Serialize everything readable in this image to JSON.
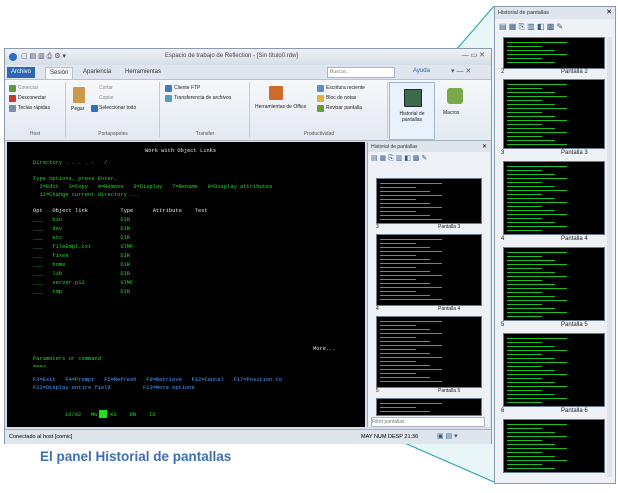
{
  "window": {
    "title": "Espacio de trabajo de Reflection - [Sin título0.rdw]",
    "search_placeholder": "Buscar...",
    "help_label": "Ayuda"
  },
  "ribbon": {
    "tabs": [
      "Archivo",
      "Sesión",
      "Apariencia",
      "Herramientas"
    ],
    "host": {
      "conectar": "Conectar",
      "desconectar": "Desconectar",
      "teclas_rapidas": "Teclas rápidas",
      "label": "Host"
    },
    "clipboard": {
      "pegar": "Pegar",
      "cortar": "Cortar",
      "copiar": "Copiar",
      "seleccionar_todo": "Seleccionar todo",
      "label": "Portapapeles"
    },
    "transfer": {
      "cliente_ftp": "Cliente FTP",
      "transferencia": "Transferencia de archivos",
      "label": "Transfer"
    },
    "productivity": {
      "herramientas_office": "Herramientas de Office",
      "escritura": "Escritura reciente",
      "bloc": "Bloc de notas",
      "revisar": "Revisar pantalla",
      "label": "Productividad"
    },
    "historial": "Historial de pantallas",
    "macros": "Macros"
  },
  "terminal": {
    "title": "Work with Object Links",
    "directory": "Directory . . . . :   /",
    "instr1": "Type options, press Enter.",
    "instr2": "  2=Edit   3=Copy   4=Remove   5=Display   7=Rename   8=Display attributes",
    "instr3": "  11=Change current directory ...",
    "header": "Opt   Object link          Type      Attribute    Text",
    "rows": [
      "___   bin                  DIR",
      "___   dev                  DIR",
      "___   etc                  DIR",
      "___   fileEmpl.txt         STMF",
      "___   fixes                DIR",
      "___   home                 DIR",
      "___   lib                  DIR",
      "___   server.p12           STMF",
      "___   tmp                  DIR"
    ],
    "more": "More...",
    "params": "Parameters or command",
    "prompt": "===>",
    "fkeys1": "F3=Exit   F4=Prompt   F5=Refresh   F9=Retrieve   F12=Cancel   F17=Position to",
    "fkeys2": "F22=Display entire field          F23=More options",
    "oia": "10/02   MW    KS    DN    ID"
  },
  "status": {
    "left": "Conectado al host [comic]",
    "right": "MAY  NUM  DESP  21:36"
  },
  "side_panel": {
    "title": "Historial de pantallas",
    "thumbs": [
      "Pantalla 3",
      "Pantalla 4",
      "Pantalla 5"
    ],
    "nums": [
      "3",
      "4",
      "5"
    ],
    "filter": "Filtro pantallas"
  },
  "big_panel": {
    "title": "Historial de pantallas",
    "items": [
      {
        "num": "2",
        "label": "Pantalla 2"
      },
      {
        "num": "3",
        "label": "Pantalla 3"
      },
      {
        "num": "4",
        "label": "Pantalla 4"
      },
      {
        "num": "5",
        "label": "Pantalla 5"
      },
      {
        "num": "6",
        "label": "Pantalla 6"
      }
    ]
  },
  "caption": "El panel Historial de pantallas",
  "colors": {
    "accent": "#3e6fb4",
    "terminal_fg": "#22dd22",
    "connector": "#1aa6a0"
  }
}
